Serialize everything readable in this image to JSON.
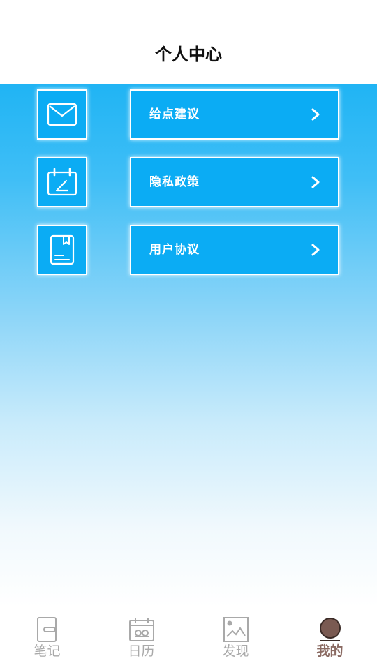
{
  "header": {
    "title": "个人中心"
  },
  "menu": {
    "items": [
      {
        "label": "给点建议",
        "icon": "mail-icon"
      },
      {
        "label": "隐私政策",
        "icon": "calendar-edit-icon"
      },
      {
        "label": "用户协议",
        "icon": "bookmark-document-icon"
      }
    ]
  },
  "tabbar": {
    "tabs": [
      {
        "label": "笔记",
        "icon": "note-icon",
        "active": false
      },
      {
        "label": "日历",
        "icon": "calendar-icon",
        "active": false
      },
      {
        "label": "发现",
        "icon": "picture-icon",
        "active": false
      },
      {
        "label": "我的",
        "icon": "profile-icon",
        "active": true
      }
    ]
  },
  "colors": {
    "accent": "#0bacf4",
    "gradient_top": "#20b4f4",
    "active_tab": "#8a6a62",
    "inactive_tab": "#a9a9a9"
  }
}
